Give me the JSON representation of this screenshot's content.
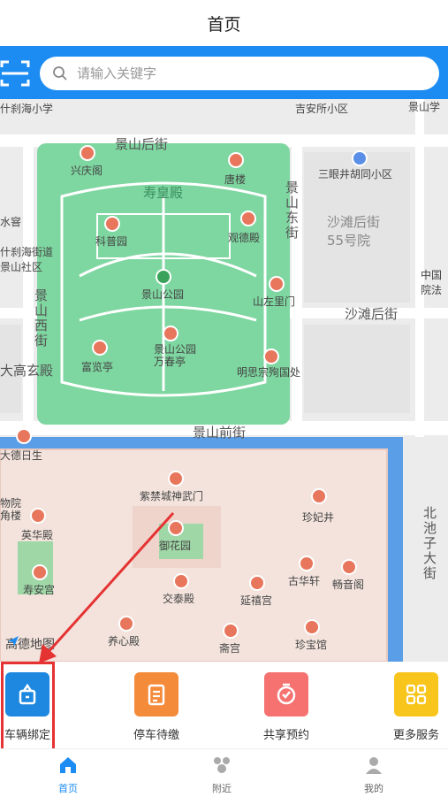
{
  "header": {
    "title": "首页"
  },
  "search": {
    "placeholder": "请输入关键字"
  },
  "map": {
    "labels": {
      "jingshan_houjie": "景山后街",
      "xingqingge": "兴庆阁",
      "shouhuangdian": "寿皇殿",
      "jilou": "唐楼",
      "keputyuan": "科普园",
      "guandedian": "观德殿",
      "jingshan_gongyuan": "景山公园",
      "shanzuolimen": "山左里门",
      "fulanting": "富览亭",
      "jingshan_wanchunting": "景山公园\n万春亭",
      "mingsi": "明思宗殉国处",
      "jingshan_qianjie": "景山前街",
      "jingshan_xijie": "景山西街",
      "jingshan_dongjie": "景山东街",
      "shatan_houjie": "沙滩后街",
      "shatan_55": "沙滩后街\n55号院",
      "sanyan": "三眼井胡同小区",
      "jian_suo": "吉安所小区",
      "jingshan_xue": "景山学",
      "shichahai_xx": "什刹海小学",
      "shichahai_jd": "什刹海街道\n景山社区",
      "dagaoxuandian": "大高玄殿",
      "dadeyisheng": "大德日生",
      "zijincheng_shenwumen": "紫禁城神武门",
      "yuhuayuan": "御花园",
      "zhenfeijing": "珍妃井",
      "yinghuadian": "英华殿",
      "shouangong": "寿安宫",
      "jiaotaidian": "交泰殿",
      "yanxigong": "延禧宫",
      "guhuaxuan": "古华轩",
      "changyinge": "畅音阁",
      "yangxindian": "养心殿",
      "zhaigong": "斋宫",
      "zhenbaoguan": "珍宝馆",
      "beichizi": "北池子大街",
      "zhongguo": "中国\n院法",
      "shuiwu": "水窨",
      "bowuyuan": "物院\n角楼",
      "shaanjiao": "沙滩后街"
    },
    "logo": "高德地图"
  },
  "services": [
    {
      "label": "车辆绑定",
      "color": "#1e88e0",
      "icon": "car-binding-icon"
    },
    {
      "label": "停车待缴",
      "color": "#f48b3a",
      "icon": "clipboard-icon"
    },
    {
      "label": "共享预约",
      "color": "#f57270",
      "icon": "timer-icon"
    },
    {
      "label": "更多服务",
      "color": "#f8c51c",
      "icon": "grid-icon"
    }
  ],
  "tabs": [
    {
      "label": "首页",
      "active": true,
      "icon": "home-icon"
    },
    {
      "label": "附近",
      "active": false,
      "icon": "nearby-icon"
    },
    {
      "label": "我的",
      "active": false,
      "icon": "profile-icon"
    }
  ],
  "colors": {
    "primary": "#1c8cf2",
    "highlight": "#e53232",
    "park": "#7ed6a0",
    "palace": "#f3e3dc",
    "moat": "#5b9ee8"
  }
}
